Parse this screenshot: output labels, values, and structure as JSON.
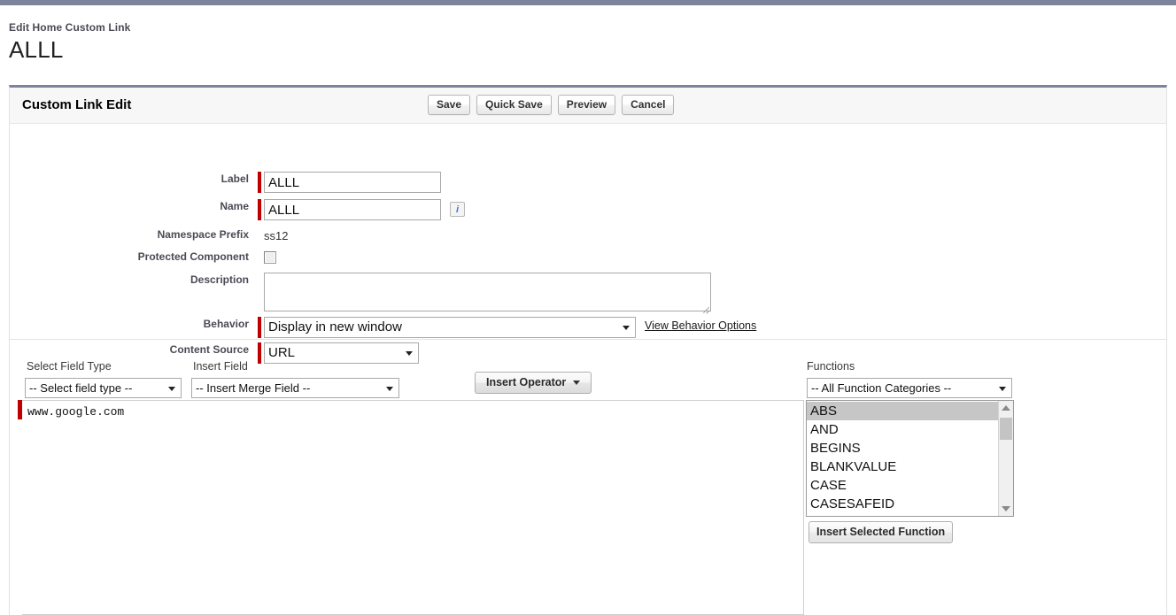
{
  "page": {
    "breadcrumb": "Edit Home Custom Link",
    "title": "ALLL"
  },
  "panel": {
    "title": "Custom Link Edit",
    "buttons": [
      {
        "label": "Save",
        "name": "save-button"
      },
      {
        "label": "Quick Save",
        "name": "quick-save-button"
      },
      {
        "label": "Preview",
        "name": "preview-button"
      },
      {
        "label": "Cancel",
        "name": "cancel-button"
      }
    ]
  },
  "form": {
    "label_field": {
      "label": "Label",
      "value": "ALLL",
      "required": true
    },
    "name_field": {
      "label": "Name",
      "value": "ALLL",
      "required": true,
      "info_icon": "info-icon"
    },
    "namespace_prefix": {
      "label": "Namespace Prefix",
      "value": "ss12"
    },
    "protected_component": {
      "label": "Protected Component",
      "checked": false
    },
    "description": {
      "label": "Description",
      "value": ""
    },
    "behavior": {
      "label": "Behavior",
      "value": "Display in new window",
      "required": true,
      "link_label": "View Behavior Options"
    },
    "content_source": {
      "label": "Content Source",
      "value": "URL",
      "required": true
    }
  },
  "formula_builder": {
    "select_field_type": {
      "label": "Select Field Type",
      "value": "-- Select field type --"
    },
    "insert_field": {
      "label": "Insert Field",
      "value": "-- Insert Merge Field --"
    },
    "insert_operator": {
      "label": "Insert Operator"
    },
    "functions": {
      "label": "Functions",
      "category_value": "-- All Function Categories --",
      "items": [
        "ABS",
        "AND",
        "BEGINS",
        "BLANKVALUE",
        "CASE",
        "CASESAFEID"
      ],
      "selected": "ABS",
      "insert_button_label": "Insert Selected Function"
    },
    "formula_value": "www.google.com"
  },
  "colors": {
    "top_bar": "#7c849c",
    "required_bar": "#c00000",
    "panel_accent": "#7c849c",
    "label_text": "#4a4a56",
    "info_icon": "#3b7ad9"
  }
}
